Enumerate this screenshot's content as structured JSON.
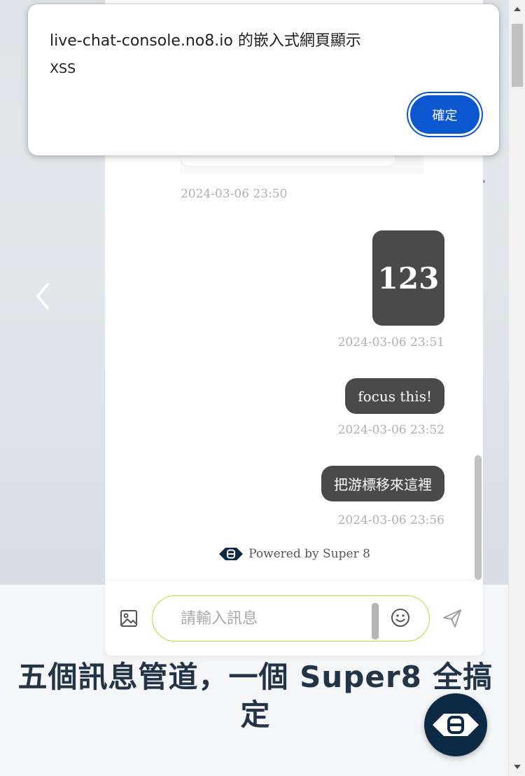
{
  "background": {
    "headline": "五個訊息管道，一個 Super8 全搞定"
  },
  "chat": {
    "messages": [
      {
        "timestamp": "2024-03-06 23:50",
        "side": "left"
      },
      {
        "text": "123",
        "timestamp": "2024-03-06 23:51",
        "side": "right"
      },
      {
        "text": "focus this!",
        "timestamp": "2024-03-06 23:52",
        "side": "right"
      },
      {
        "text": "把游標移來這裡",
        "timestamp": "2024-03-06 23:56",
        "side": "right"
      }
    ],
    "powered_by": "Powered by Super 8",
    "input": {
      "value": "",
      "placeholder": "請輸入訊息"
    },
    "colors": {
      "bubble": "#4a4a4a",
      "input_border": "#c6d835",
      "brand_dark": "#0d2a45"
    },
    "icons": {
      "attach": "image-icon",
      "emoji": "smiley-icon",
      "send": "send-icon",
      "logo": "super8-logo-icon"
    }
  },
  "dialog": {
    "title": "live-chat-console.no8.io 的嵌入式網頁顯示",
    "message": "XSS",
    "ok_label": "確定",
    "accent": "#0b57d0"
  }
}
